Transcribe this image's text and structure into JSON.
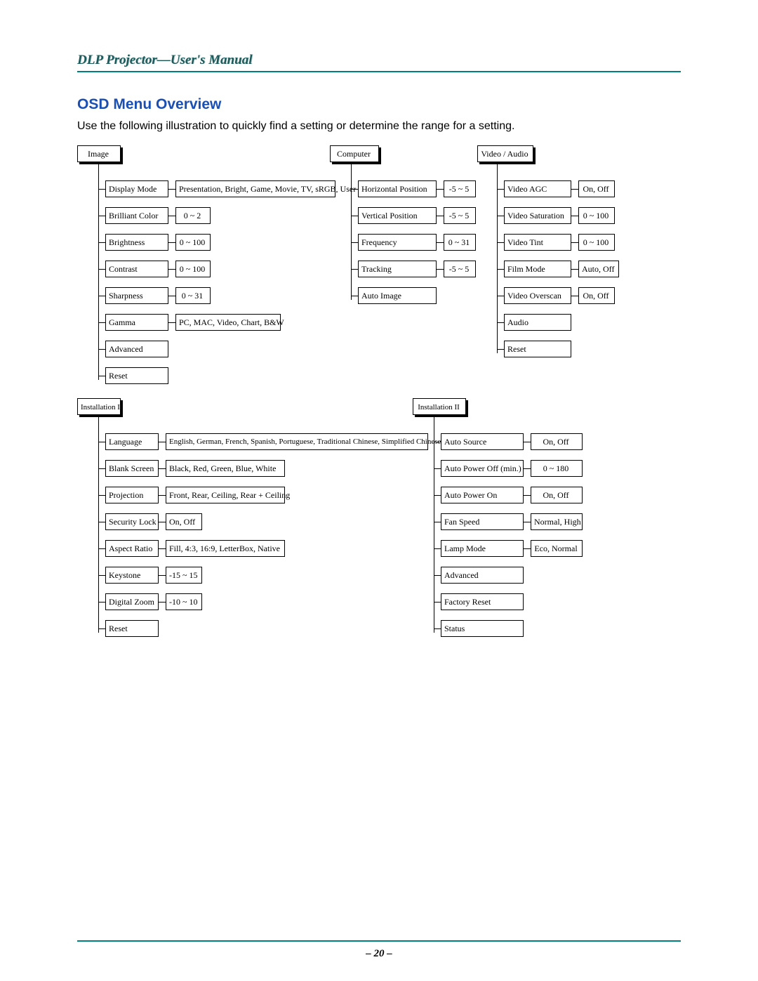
{
  "header": "DLP Projector—User's Manual",
  "section_title": "OSD Menu Overview",
  "intro": "Use the following illustration to quickly find a setting or determine the range for a setting.",
  "page_number": "– 20 –",
  "menus": {
    "image": {
      "title": "Image",
      "items": [
        {
          "label": "Display Mode",
          "range": "Presentation, Bright, Game, Movie, TV, sRGB, User"
        },
        {
          "label": "Brilliant Color",
          "range": "0 ~ 2"
        },
        {
          "label": "Brightness",
          "range": "0 ~ 100"
        },
        {
          "label": "Contrast",
          "range": "0 ~ 100"
        },
        {
          "label": "Sharpness",
          "range": "0 ~ 31"
        },
        {
          "label": "Gamma",
          "range": "PC, MAC, Video, Chart, B&W"
        },
        {
          "label": "Advanced"
        },
        {
          "label": "Reset"
        }
      ]
    },
    "computer": {
      "title": "Computer",
      "items": [
        {
          "label": "Horizontal Position",
          "range": "-5 ~ 5"
        },
        {
          "label": "Vertical Position",
          "range": "-5 ~ 5"
        },
        {
          "label": "Frequency",
          "range": "0 ~ 31"
        },
        {
          "label": "Tracking",
          "range": "-5 ~ 5"
        },
        {
          "label": "Auto Image"
        }
      ]
    },
    "video": {
      "title": "Video / Audio",
      "items": [
        {
          "label": "Video AGC",
          "range": "On, Off"
        },
        {
          "label": "Video Saturation",
          "range": "0 ~ 100"
        },
        {
          "label": "Video Tint",
          "range": "0 ~ 100"
        },
        {
          "label": "Film Mode",
          "range": "Auto, Off"
        },
        {
          "label": "Video Overscan",
          "range": "On, Off"
        },
        {
          "label": "Audio"
        },
        {
          "label": "Reset"
        }
      ]
    },
    "install1": {
      "title": "Installation I",
      "items": [
        {
          "label": "Language",
          "range": "English, German, French, Spanish, Portuguese, Traditional Chinese, Simplified Chinese"
        },
        {
          "label": "Blank Screen",
          "range": "Black, Red, Green, Blue, White"
        },
        {
          "label": "Projection",
          "range": "Front, Rear, Ceiling, Rear + Ceiling"
        },
        {
          "label": "Security Lock",
          "range": "On, Off"
        },
        {
          "label": "Aspect Ratio",
          "range": "Fill, 4:3, 16:9, LetterBox, Native"
        },
        {
          "label": "Keystone",
          "range": "-15 ~ 15"
        },
        {
          "label": "Digital Zoom",
          "range": "-10 ~ 10"
        },
        {
          "label": "Reset"
        }
      ]
    },
    "install2": {
      "title": "Installation II",
      "items": [
        {
          "label": "Auto Source",
          "range": "On, Off"
        },
        {
          "label": "Auto Power Off (min.)",
          "range": "0 ~ 180"
        },
        {
          "label": "Auto Power On",
          "range": "On, Off"
        },
        {
          "label": "Fan Speed",
          "range": "Normal, High"
        },
        {
          "label": "Lamp Mode",
          "range": "Eco, Normal"
        },
        {
          "label": "Advanced"
        },
        {
          "label": "Factory Reset"
        },
        {
          "label": "Status"
        }
      ]
    }
  }
}
